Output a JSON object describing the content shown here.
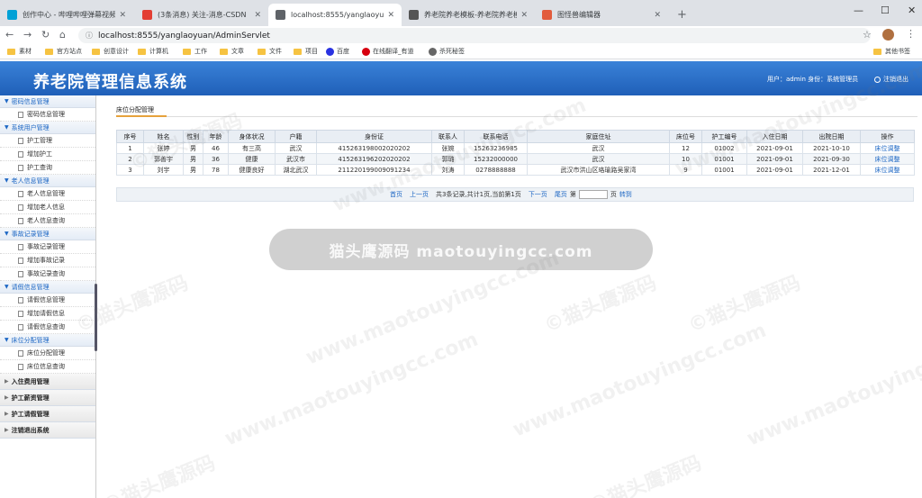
{
  "browser": {
    "tabs": [
      {
        "title": "创作中心 - 哔哩哔哩弹幕视频网",
        "icon_color": "#00a1d6",
        "active": false
      },
      {
        "title": "(3条消息) 关注-消息-CSDN",
        "icon_color": "#e33e33",
        "active": false
      },
      {
        "title": "localhost:8555/yanglaoyuan/A",
        "icon_color": "#5f6368",
        "active": true
      },
      {
        "title": "养老院养老模板-养老院养老模板",
        "icon_color": "#555555",
        "active": false
      },
      {
        "title": "图怪兽编辑器",
        "icon_color": "#e25c3d",
        "active": false
      }
    ],
    "url": "localhost:8555/yanglaoyuan/AdminServlet",
    "bookmarks": [
      "素材",
      "官方站点",
      "创意设计",
      "计算机",
      "工作",
      "文章",
      "文件",
      "项目",
      "百度",
      "在线翻译_有道",
      "杀死秘签"
    ],
    "other_bookmarks": "其他书签"
  },
  "header": {
    "title": "养老院管理信息系统",
    "user_info": "用户：admin 身份：系统管理员",
    "logout": "注销退出"
  },
  "sidebar": [
    {
      "label": "密码信息管理",
      "open": true,
      "items": [
        "密码信息管理"
      ]
    },
    {
      "label": "系统用户管理",
      "open": true,
      "items": [
        "护工管理",
        "增加护工",
        "护工查询"
      ]
    },
    {
      "label": "老人信息管理",
      "open": true,
      "items": [
        "老人信息管理",
        "增加老人信息",
        "老人信息查询"
      ]
    },
    {
      "label": "事故记录管理",
      "open": true,
      "items": [
        "事故记录管理",
        "增加事故记录",
        "事故记录查询"
      ]
    },
    {
      "label": "请假信息管理",
      "open": true,
      "items": [
        "请假信息管理",
        "增加请假信息",
        "请假信息查询"
      ]
    },
    {
      "label": "床位分配管理",
      "open": true,
      "items": [
        "床位分配管理",
        "床位信息查询"
      ]
    },
    {
      "label": "入住费用管理",
      "open": false,
      "items": []
    },
    {
      "label": "护工薪资管理",
      "open": false,
      "items": []
    },
    {
      "label": "护工请假管理",
      "open": false,
      "items": []
    },
    {
      "label": "注销退出系统",
      "open": false,
      "items": []
    }
  ],
  "main": {
    "tab_title": "床位分配管理",
    "columns": [
      "序号",
      "姓名",
      "性别",
      "年龄",
      "身体状况",
      "户籍",
      "身份证",
      "联系人",
      "联系电话",
      "家庭住址",
      "床位号",
      "护工编号",
      "入住日期",
      "出院日期",
      "操作"
    ],
    "rows": [
      [
        "1",
        "张婷",
        "男",
        "46",
        "有三高",
        "武汉",
        "415263198002020202",
        "张婉",
        "15263236985",
        "武汉",
        "12",
        "01002",
        "2021-09-01",
        "2021-10-10",
        "床位调整"
      ],
      [
        "2",
        "郭善宇",
        "男",
        "36",
        "健康",
        "武汉市",
        "415263196202020202",
        "郭璐",
        "15232000000",
        "武汉",
        "10",
        "01001",
        "2021-09-01",
        "2021-09-30",
        "床位调整"
      ],
      [
        "3",
        "刘宇",
        "男",
        "78",
        "健康良好",
        "湖北武汉",
        "211220199009091234",
        "刘涛",
        "0278888888",
        "武汉市洪山区珞瑜路吴家湾",
        "9",
        "01001",
        "2021-09-01",
        "2021-12-01",
        "床位调整"
      ]
    ],
    "pager": {
      "first": "首页",
      "prev": "上一页",
      "summary": "共3条记录,共计1页,当前第1页",
      "next": "下一页",
      "last": "尾页",
      "goto_prefix": "第",
      "goto_suffix": "页",
      "goto_btn": "转到"
    }
  },
  "overlay": {
    "toast": "猫头鹰源码 maotouyingcc.com",
    "watermark_cn": "©猫头鹰源码",
    "watermark_en": "www.maotouyingcc.com"
  }
}
